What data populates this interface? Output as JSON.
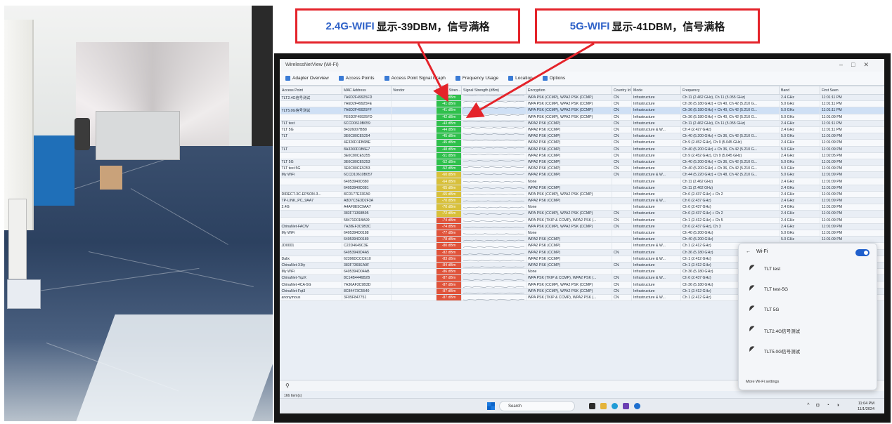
{
  "callouts": {
    "left": {
      "band": "2.4G-WIFI",
      "text": "显示-39DBM，信号满格"
    },
    "right": {
      "band": "5G-WIFI",
      "text": "显示-41DBM，信号满格"
    }
  },
  "window": {
    "title": "WirelessNetView (Wi-Fi)"
  },
  "toolbar": {
    "items": [
      "Adapter Overview",
      "Access Points",
      "Access Point Signal Graph",
      "Frequency Usage",
      "Location",
      "Options"
    ]
  },
  "table": {
    "columns": [
      "Access Point",
      "MAC Address",
      "Vendor",
      "Signal Stren...",
      "Signal Strength (dBm)",
      "Encryption",
      "Country Id",
      "Mode",
      "Frequency",
      "Band",
      "First Seen"
    ],
    "rows": [
      [
        "TLT2.4G信号测试",
        "7A6D2F49925FD",
        "",
        "-39 dBm",
        "WPA PSK (CCMP), WPA2 PSK (CCMP)",
        "CN",
        "Infrastructure",
        "Ch 11 (2.462 GHz), Ch 11 (5.055 GHz)",
        "2.4 GHz",
        "11:01:11 PM"
      ],
      [
        "",
        "7A6D2F49925FE",
        "",
        "-41 dBm",
        "WPA PSK (CCMP), WPA2 PSK (CCMP)",
        "CN",
        "Infrastructure",
        "Ch 36 (5.180 GHz) + Ch 40, Ch 42 (5.210 G...",
        "5.0 GHz",
        "11:01:11 PM"
      ],
      [
        "TLT5.0G信号测试",
        "7A6D2F49925FF",
        "",
        "-41 dBm",
        "WPA PSK (CCMP), WPA2 PSK (CCMP)",
        "CN",
        "Infrastructure",
        "Ch 36 (5.180 GHz) + Ch 40, Ch 42 (5.210 G...",
        "5.0 GHz",
        "11:01:11 PM"
      ],
      [
        "",
        "FE6D2F49925FD",
        "",
        "-42 dBm",
        "WPA PSK (CCMP), WPA2 PSK (CCMP)",
        "CN",
        "Infrastructure",
        "Ch 36 (5.180 GHz) + Ch 40, Ch 42 (5.210 G...",
        "5.0 GHz",
        "11:01:09 PM"
      ],
      [
        "TLT test",
        "6CCD0610B059",
        "",
        "-43 dBm",
        "WPA2 PSK (CCMP)",
        "CN",
        "Infrastructure",
        "Ch 11 (2.462 GHz), Ch 11 (5.055 GHz)",
        "2.4 GHz",
        "11:01:11 PM"
      ],
      [
        "TLT 5G",
        "84326007BB8",
        "",
        "-44 dBm",
        "WPA2 PSK (CCMP)",
        "CN",
        "Infrastructure & W...",
        "Ch 4 (2.427 GHz)",
        "2.4 GHz",
        "11:01:11 PM"
      ],
      [
        "TLT",
        "3E0C80CE5254",
        "",
        "-45 dBm",
        "WPA2 PSK (CCMP)",
        "CN",
        "Infrastructure",
        "Ch 40 (5.200 GHz) + Ch 36, Ch 42 (5.210 G...",
        "5.0 GHz",
        "11:01:09 PM"
      ],
      [
        "",
        "4E326D1FB6BE",
        "",
        "-45 dBm",
        "WPA2 PSK (CCMP)",
        "CN",
        "Infrastructure",
        "Ch 9 (2.452 GHz), Ch 9 (5.045 GHz)",
        "2.4 GHz",
        "11:01:09 PM"
      ],
      [
        "TLT",
        "8A3260D1B6E7",
        "",
        "-48 dBm",
        "WPA2 PSK (CCMP)",
        "CN",
        "Infrastructure",
        "Ch 40 (5.200 GHz) + Ch 36, Ch 42 (5.210 G...",
        "5.0 GHz",
        "11:01:09 PM"
      ],
      [
        "",
        "3E0C80CE5255",
        "",
        "-51 dBm",
        "WPA2 PSK (CCMP)",
        "CN",
        "Infrastructure",
        "Ch 9 (2.452 GHz), Ch 9 (5.045 GHz)",
        "2.4 GHz",
        "11:02:05 PM"
      ],
      [
        "TLT 5G",
        "3E0C80CE5253",
        "",
        "-52 dBm",
        "WPA2 PSK (CCMP)",
        "CN",
        "Infrastructure",
        "Ch 40 (5.200 GHz) + Ch 36, Ch 42 (5.210 G...",
        "5.0 GHz",
        "11:01:09 PM"
      ],
      [
        "TLT test 5G",
        "3E0C80CE5253",
        "",
        "-52 dBm",
        "WPA2 PSK (CCMP)",
        "CN",
        "Infrastructure",
        "Ch 40 (5.200 GHz) + Ch 36, Ch 42 (5.210 G...",
        "5.0 GHz",
        "11:01:09 PM"
      ],
      [
        "My WiFi",
        "6CCD10610B057",
        "",
        "-60 dBm",
        "WPA2 PSK (CCMP)",
        "CN",
        "Infrastructure & W...",
        "Ch 44 (5.220 GHz) + Ch 48, Ch 42 (5.210 G...",
        "5.0 GHz",
        "11:01:09 PM"
      ],
      [
        "",
        "64053940D380",
        "",
        "-64 dBm",
        "None",
        "",
        "Infrastructure",
        "Ch 11 (2.462 GHz)",
        "2.4 GHz",
        "11:01:09 PM"
      ],
      [
        "",
        "64053940D381",
        "",
        "-65 dBm",
        "WPA2 PSK (CCMP)",
        "",
        "Infrastructure",
        "Ch 11 (2.462 GHz)",
        "2.4 GHz",
        "11:01:09 PM"
      ],
      [
        "DIRECT-3C-EPSON-3...",
        "8CD177E33FA0",
        "",
        "-65 dBm",
        "WPA PSK (CCMP), WPA2 PSK (CCMP)",
        "",
        "Infrastructure",
        "Ch 6 (2.437 GHz) + Ch 2",
        "2.4 GHz",
        "11:01:09 PM"
      ],
      [
        "TP-LINK_PC_9AA7",
        "A8D7C3E3D2F3A",
        "",
        "-70 dBm",
        "WPA2 PSK (CCMP)",
        "",
        "Infrastructure & W...",
        "Ch 6 (2.437 GHz)",
        "2.4 GHz",
        "11:01:09 PM"
      ],
      [
        "2.4G",
        "A4AF8E5C9AA7",
        "",
        "-70 dBm",
        "None",
        "",
        "Infrastructure",
        "Ch 6 (2.437 GHz)",
        "2.4 GHz",
        "11:01:09 PM"
      ],
      [
        "",
        "383F71368B95",
        "",
        "-72 dBm",
        "WPA PSK (CCMP), WPA2 PSK (CCMP)",
        "CN",
        "Infrastructure",
        "Ch 6 (2.437 GHz) + Ch 2",
        "2.4 GHz",
        "11:01:09 PM"
      ],
      [
        "",
        "58471D01BA99",
        "",
        "-74 dBm",
        "WPA PSK (TKIP & CCMP), WPA2 PSK (...",
        "CN",
        "Infrastructure",
        "Ch 1 (2.412 GHz) + Ch 5",
        "2.4 GHz",
        "11:01:09 PM"
      ],
      [
        "ChinaNet-FACW",
        "7A28EF3C9B3C",
        "",
        "-74 dBm",
        "WPA PSK (CCMP), WPA2 PSK (CCMP)",
        "CN",
        "Infrastructure",
        "Ch 6 (2.437 GHz), Ch 3",
        "2.4 GHz",
        "11:01:09 PM"
      ],
      [
        "My WiFi",
        "6405394D0188",
        "",
        "-77 dBm",
        "None",
        "",
        "Infrastructure",
        "Ch 40 (5.200 GHz)",
        "5.0 GHz",
        "11:01:09 PM"
      ],
      [
        "",
        "6405394D0189",
        "",
        "-78 dBm",
        "WPA2 PSK (CCMP)",
        "",
        "Infrastructure",
        "Ch 40 (5.200 GHz)",
        "5.0 GHz",
        "11:01:09 PM"
      ],
      [
        "JD0001",
        "C22D4649C3E",
        "",
        "-80 dBm",
        "WPA2 PSK (CCMP)",
        "",
        "Infrastructure & W...",
        "Ch 1 (2.412 GHz)",
        "2.4 GHz",
        "11:01:09 PM"
      ],
      [
        "",
        "64053940D4A5",
        "",
        "-82 dBm",
        "WPA2 PSK (CCMP)",
        "CN",
        "Infrastructure",
        "Ch 36 (5.180 GHz)",
        "5.0 GHz",
        "11:01:09 PM"
      ],
      [
        "Dalix",
        "62396DCCCE10",
        "",
        "-83 dBm",
        "WPA2 PSK (CCMP)",
        "",
        "Infrastructure & W...",
        "Ch 1 (2.412 GHz)",
        "2.4 GHz",
        "11:01:09 PM"
      ],
      [
        "ChinaNet-X3ty",
        "383F7369EA9F",
        "",
        "-84 dBm",
        "WPA2 PSK (CCMP)",
        "CN",
        "Infrastructure",
        "Ch 1 (2.412 GHz)",
        "2.4 GHz",
        "11:01:09 PM"
      ],
      [
        "My WiFi",
        "6405394D04AB",
        "",
        "-86 dBm",
        "None",
        "",
        "Infrastructure",
        "Ch 36 (5.180 GHz)",
        "5.0 GHz",
        "11:01:09 PM"
      ],
      [
        "ChinaNet-YqzX",
        "8C14B4446B2B",
        "",
        "-87 dBm",
        "WPA PSK (TKIP & CCMP), WPA2 PSK (...",
        "CN",
        "Infrastructure & W...",
        "Ch 6 (2.437 GHz)",
        "2.4 GHz",
        "11:01:09 PM"
      ],
      [
        "ChinaNet-4CA-5G",
        "7A36AF3C9B3D",
        "",
        "-87 dBm",
        "WPA PSK (CCMP), WPA2 PSK (CCMP)",
        "CN",
        "Infrastructure",
        "Ch 36 (5.180 GHz)",
        "5.0 GHz",
        "11:01:09 PM"
      ],
      [
        "ChinaNet-Fqt3",
        "8C84473C5540",
        "",
        "-87 dBm",
        "WPA PSK (CCMP), WPA2 PSK (CCMP)",
        "CN",
        "Infrastructure",
        "Ch 1 (2.412 GHz)",
        "2.4 GHz",
        "11:01:09 PM"
      ],
      [
        "anonymous",
        "3F05F847751",
        "",
        "-87 dBm",
        "WPA PSK (TKIP & CCMP), WPA2 PSK (...",
        "CN",
        "Infrastructure & W...",
        "Ch 1 (2.412 GHz)",
        "2.4 GHz",
        "11:01:09 PM"
      ]
    ],
    "selected_row": 2
  },
  "statusbar": {
    "text": "166 Item(s)"
  },
  "wifi_flyout": {
    "title": "Wi-Fi",
    "networks": [
      "TLT test",
      "TLT test-5G",
      "TLT 5G",
      "TLT2.4G信号测试",
      "TLT5.0G信号测试"
    ],
    "more": "More Wi-Fi settings"
  },
  "taskbar": {
    "search": "Search",
    "time": "11:04 PM",
    "date": "11/1/2024"
  },
  "colors": {
    "accent": "#e4232a",
    "band": "#2f62c8",
    "strong": "#2fc04c",
    "medium": "#d8c03a",
    "weak": "#e0533a"
  }
}
